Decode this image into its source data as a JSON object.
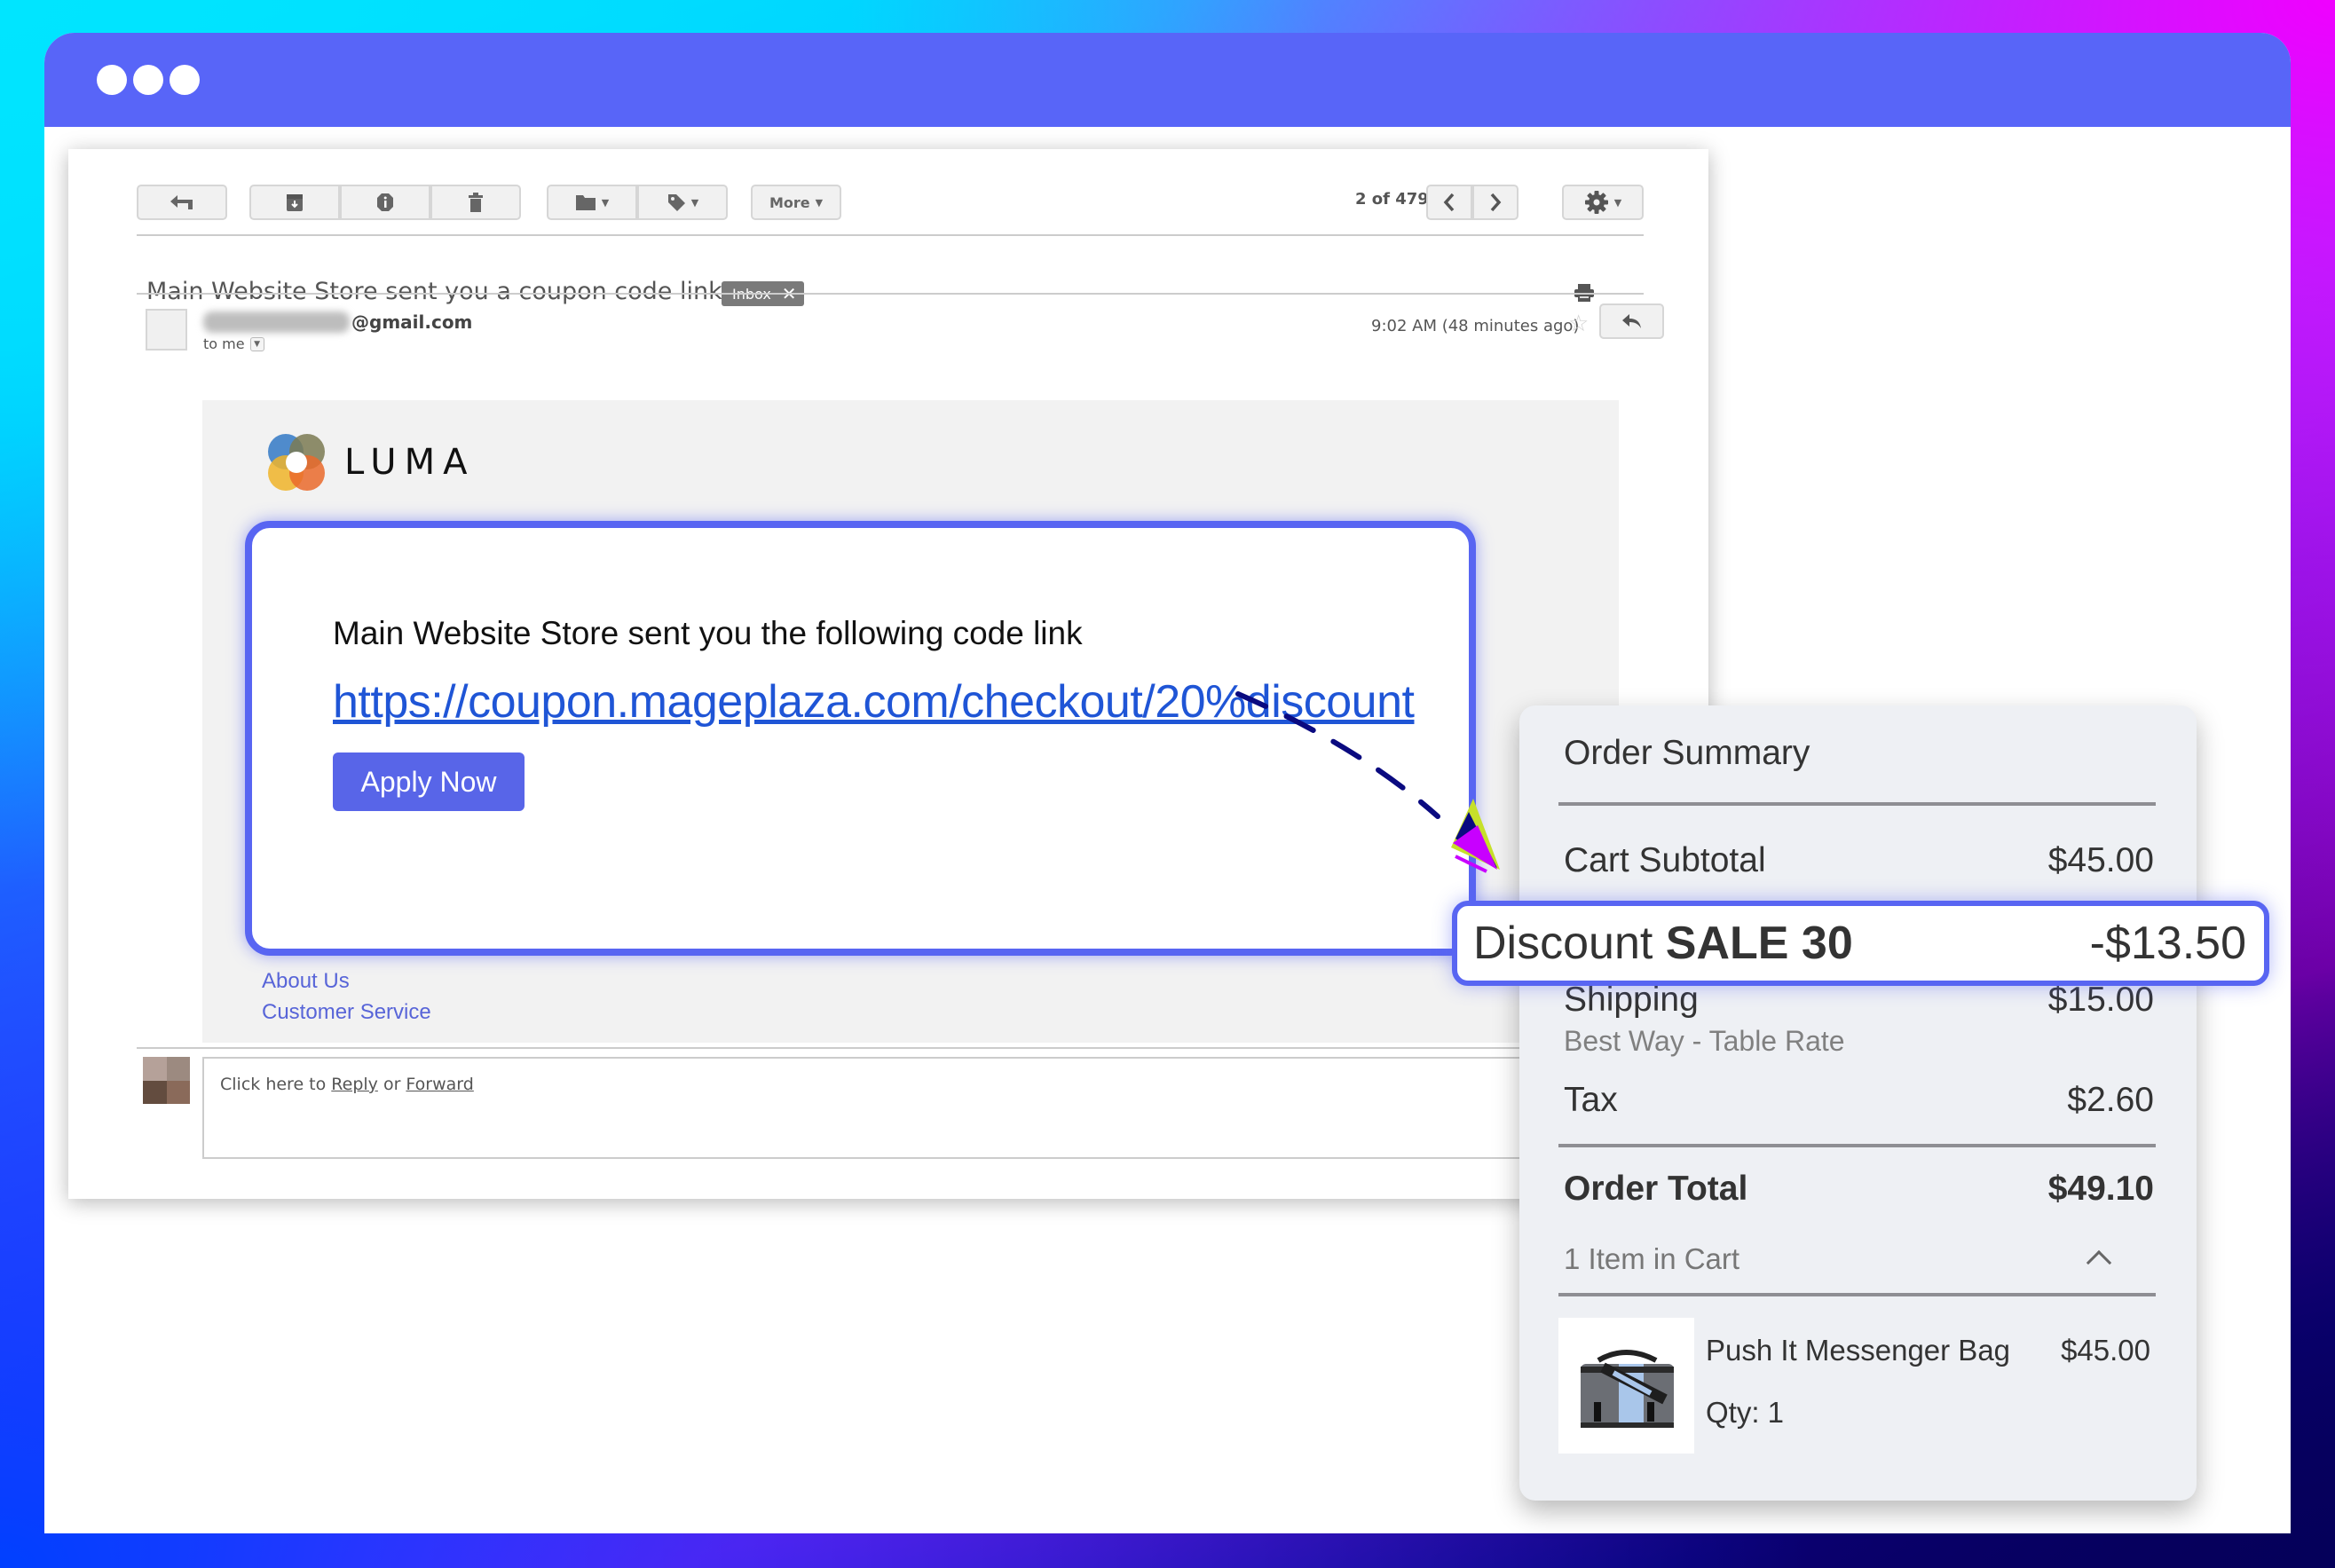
{
  "window": {
    "title_dots": 3,
    "colors": {
      "titlebar": "#5865f8",
      "accent": "#5865f2",
      "link": "#1f55d6"
    }
  },
  "gmail": {
    "toolbar": {
      "reply_icon": "reply-arrow-icon",
      "archive_icon": "archive-icon",
      "report_icon": "report-spam-icon",
      "delete_icon": "trash-icon",
      "move_icon": "folder-icon",
      "labels_icon": "tag-icon",
      "more_label": "More",
      "pager_text": "2 of 479",
      "settings_icon": "gear-icon"
    },
    "subject": "Main Website Store sent you a coupon code link",
    "label_badge": "Inbox",
    "sender": {
      "email_suffix": "@gmail.com",
      "to_line": "to me",
      "timestamp": "9:02 AM (48 minutes ago)"
    },
    "email": {
      "brand": "LUMA",
      "heading": "Main Website Store sent you the following code link",
      "link": "https://coupon.mageplaza.com/checkout/20%discount",
      "button": "Apply Now",
      "footer_links": [
        "About Us",
        "Customer Service"
      ]
    },
    "reply_box": {
      "prefix": "Click here to ",
      "reply": "Reply",
      "middle": " or ",
      "forward": "Forward"
    }
  },
  "order_summary": {
    "title": "Order Summary",
    "rows": [
      {
        "label": "Cart Subtotal",
        "value": "$45.00"
      },
      {
        "label": "Shipping",
        "value": "$15.00",
        "sub": "Best Way - Table Rate"
      },
      {
        "label": "Tax",
        "value": "$2.60"
      }
    ],
    "discount": {
      "label": "Discount",
      "code": "SALE 30",
      "value": "-$13.50"
    },
    "total": {
      "label": "Order Total",
      "value": "$49.10"
    },
    "cart_toggle": "1 Item in Cart",
    "items": [
      {
        "name": "Push It Messenger Bag",
        "price": "$45.00",
        "qty": "Qty: 1"
      }
    ]
  }
}
